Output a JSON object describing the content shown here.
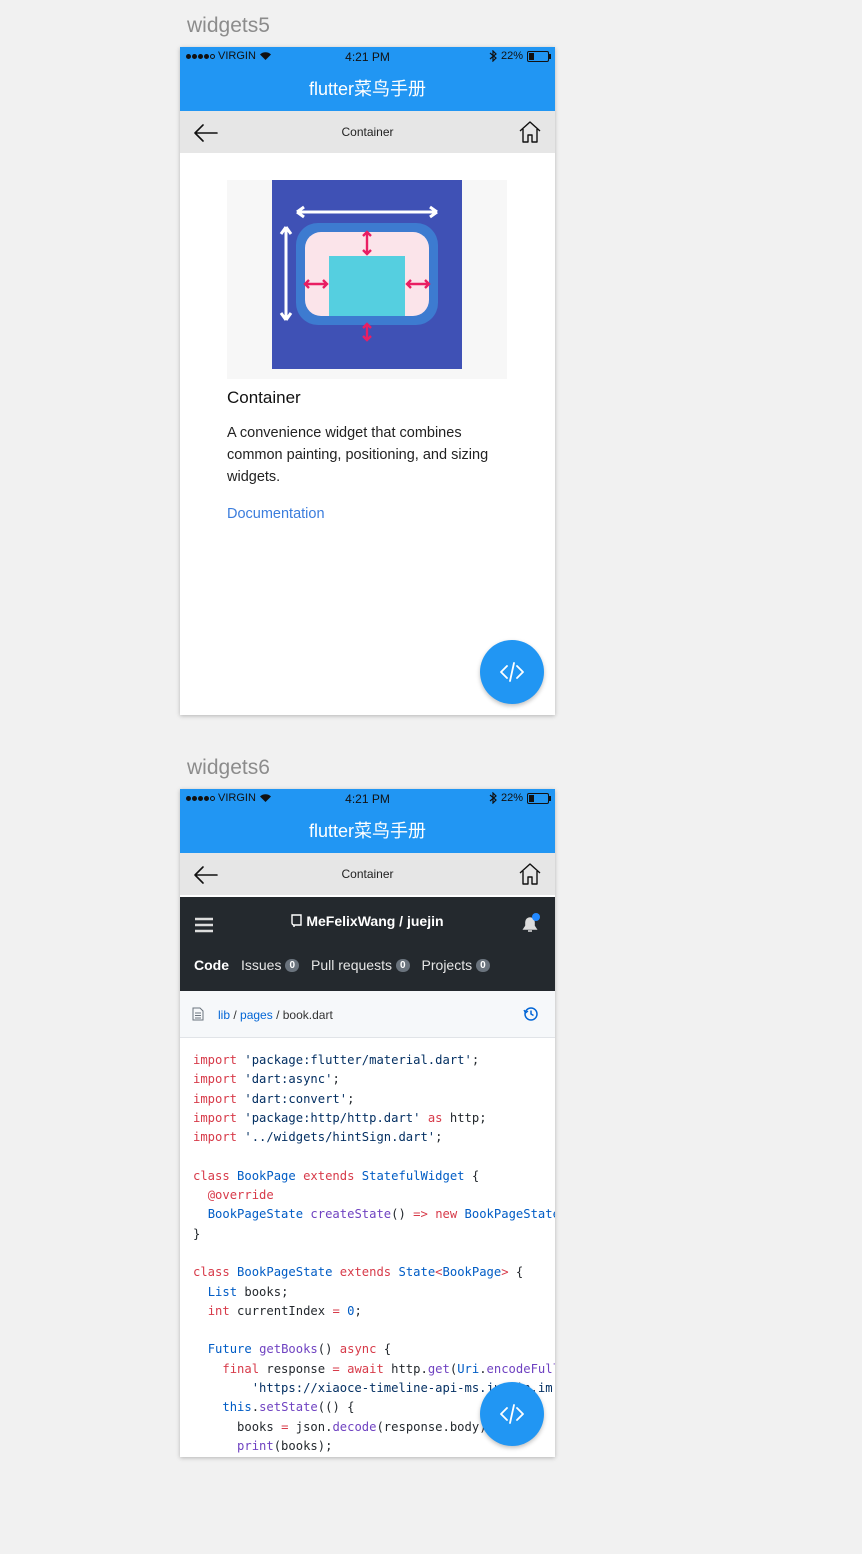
{
  "boards": {
    "first": {
      "label": "widgets5"
    },
    "second": {
      "label": "widgets6"
    }
  },
  "status_bar": {
    "carrier": "VIRGIN",
    "time": "4:21 PM",
    "battery": "22%"
  },
  "app_bar": {
    "title": "flutter菜鸟手册"
  },
  "nav_bar": {
    "title": "Container",
    "back_icon": "arrow-left-icon",
    "home_icon": "home-icon"
  },
  "widget_detail": {
    "title": "Container",
    "description": "A convenience widget that combines common painting, positioning, and sizing widgets.",
    "link": "Documentation",
    "image_colors": {
      "background": "#3f51b5",
      "frame": "#3d7bd0",
      "inner": "#fbe4ea",
      "child": "#55cfe0",
      "arrows": "#e91e63"
    }
  },
  "fab": {
    "icon": "code-icon",
    "color": "#2196f3"
  },
  "github": {
    "repo_owner": "MeFelixWang",
    "repo_sep": " / ",
    "repo_name": "juejin",
    "tabs": [
      {
        "label": "Code"
      },
      {
        "label": "Issues",
        "count": "0"
      },
      {
        "label": "Pull requests",
        "count": "0"
      },
      {
        "label": "Projects",
        "count": "0"
      }
    ],
    "breadcrumb": {
      "lib": "lib",
      "sep": " / ",
      "pages": "pages",
      "sep2": " / ",
      "file": "book.dart"
    }
  }
}
